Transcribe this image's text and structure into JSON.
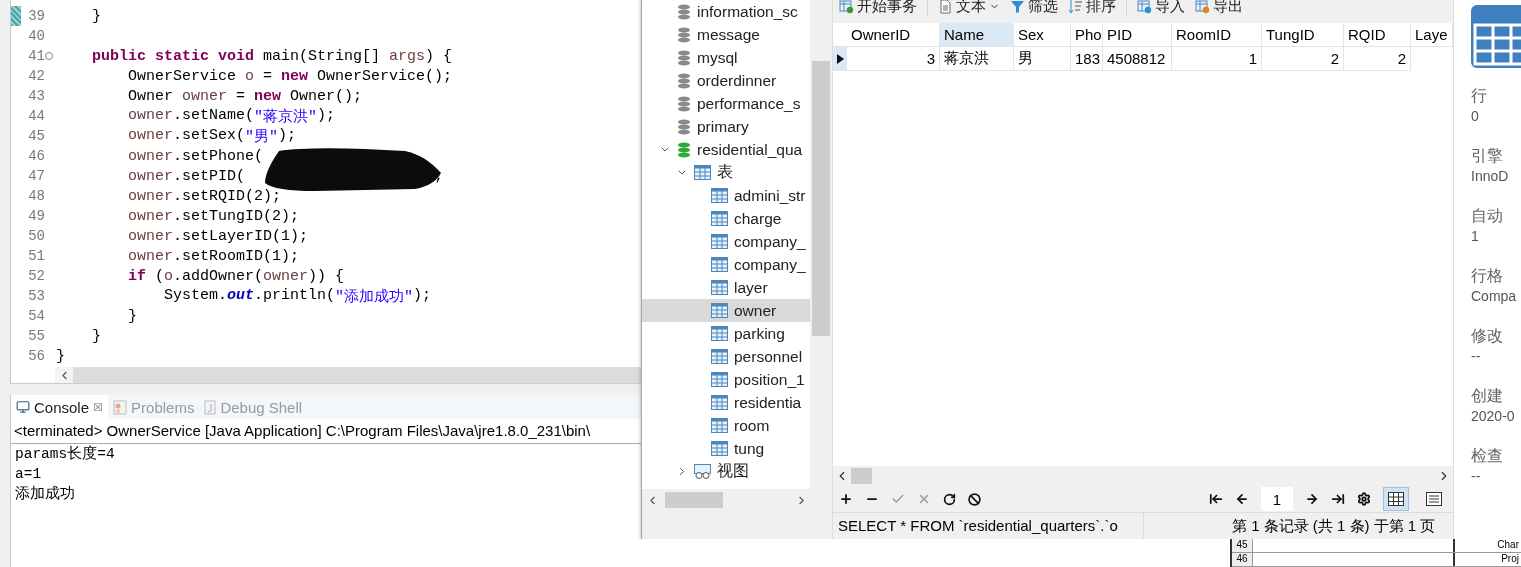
{
  "editor": {
    "lines": [
      {
        "number": "39",
        "marker": true,
        "tokens": [
          {
            "kind": "plain",
            "text": "    }"
          }
        ]
      },
      {
        "number": "40"
      },
      {
        "number": "41",
        "fold": true,
        "tokens": [
          {
            "kind": "keyword",
            "text": "    public static void"
          },
          {
            "kind": "plain",
            "text": " main(String[] "
          },
          {
            "kind": "variable",
            "text": "args"
          },
          {
            "kind": "plain",
            "text": ") {"
          }
        ]
      },
      {
        "number": "42",
        "tokens": [
          {
            "kind": "plain",
            "text": "        OwnerService "
          },
          {
            "kind": "variable",
            "text": "o"
          },
          {
            "kind": "plain",
            "text": " = "
          },
          {
            "kind": "keyword",
            "text": "new"
          },
          {
            "kind": "plain",
            "text": " OwnerService();"
          }
        ]
      },
      {
        "number": "43",
        "tokens": [
          {
            "kind": "plain",
            "text": "        Owner "
          },
          {
            "kind": "variable",
            "text": "owner"
          },
          {
            "kind": "plain",
            "text": " = "
          },
          {
            "kind": "keyword",
            "text": "new"
          },
          {
            "kind": "plain",
            "text": " Owner();"
          }
        ]
      },
      {
        "number": "44",
        "tokens": [
          {
            "kind": "variable",
            "text": "        owner"
          },
          {
            "kind": "plain",
            "text": ".setName("
          },
          {
            "kind": "string",
            "text": "\"蒋京洪\""
          },
          {
            "kind": "plain",
            "text": ");"
          }
        ]
      },
      {
        "number": "45",
        "tokens": [
          {
            "kind": "variable",
            "text": "        owner"
          },
          {
            "kind": "plain",
            "text": ".setSex("
          },
          {
            "kind": "string",
            "text": "\"男\""
          },
          {
            "kind": "plain",
            "text": ");"
          }
        ]
      },
      {
        "number": "46",
        "tokens": [
          {
            "kind": "variable",
            "text": "        owner"
          },
          {
            "kind": "plain",
            "text": ".setPhone("
          }
        ]
      },
      {
        "number": "47",
        "tokens": [
          {
            "kind": "variable",
            "text": "        owner"
          },
          {
            "kind": "plain",
            "text": ".setPID("
          }
        ],
        "after_redaction": ";"
      },
      {
        "number": "48",
        "tokens": [
          {
            "kind": "variable",
            "text": "        owner"
          },
          {
            "kind": "plain",
            "text": ".setRQID(2);"
          }
        ]
      },
      {
        "number": "49",
        "tokens": [
          {
            "kind": "variable",
            "text": "        owner"
          },
          {
            "kind": "plain",
            "text": ".setTungID(2);"
          }
        ]
      },
      {
        "number": "50",
        "tokens": [
          {
            "kind": "variable",
            "text": "        owner"
          },
          {
            "kind": "plain",
            "text": ".setLayerID(1);"
          }
        ]
      },
      {
        "number": "51",
        "tokens": [
          {
            "kind": "variable",
            "text": "        owner"
          },
          {
            "kind": "plain",
            "text": ".setRoomID(1);"
          }
        ]
      },
      {
        "number": "52",
        "tokens": [
          {
            "kind": "keyword",
            "text": "        if"
          },
          {
            "kind": "plain",
            "text": " ("
          },
          {
            "kind": "variable",
            "text": "o"
          },
          {
            "kind": "plain",
            "text": ".addOwner("
          },
          {
            "kind": "variable",
            "text": "owner"
          },
          {
            "kind": "plain",
            "text": ")) {"
          }
        ]
      },
      {
        "number": "53",
        "tokens": [
          {
            "kind": "plain",
            "text": "            System."
          },
          {
            "kind": "static",
            "text": "out"
          },
          {
            "kind": "plain",
            "text": ".println("
          },
          {
            "kind": "string",
            "text": "\"添加成功\""
          },
          {
            "kind": "plain",
            "text": ");"
          }
        ]
      },
      {
        "number": "54",
        "tokens": [
          {
            "kind": "plain",
            "text": "        }"
          }
        ]
      },
      {
        "number": "55",
        "tokens": [
          {
            "kind": "plain",
            "text": "    }"
          }
        ]
      },
      {
        "number": "56",
        "tokens": [
          {
            "kind": "plain",
            "text": "}"
          }
        ]
      }
    ]
  },
  "console": {
    "tabs": [
      {
        "label": "Console",
        "kind": "console",
        "selected": true,
        "close": "☒"
      },
      {
        "label": "Problems",
        "kind": "problems",
        "selected": false
      },
      {
        "label": "Debug Shell",
        "kind": "debug",
        "selected": false
      }
    ],
    "header": "<terminated> OwnerService [Java Application] C:\\Program Files\\Java\\jre1.8.0_231\\bin\\",
    "output": [
      "params长度=4",
      "a=1",
      "添加成功"
    ]
  },
  "navicat": {
    "tree": [
      {
        "name": "information_sc",
        "open": false,
        "selected": false
      },
      {
        "name": "message",
        "open": false,
        "selected": false
      },
      {
        "name": "mysql",
        "open": false,
        "selected": false
      },
      {
        "name": "orderdinner",
        "open": false,
        "selected": false
      },
      {
        "name": "performance_s",
        "open": false,
        "selected": false
      },
      {
        "name": "primary",
        "open": false,
        "selected": false
      },
      {
        "name": "residential_qua",
        "open": true,
        "selected": false,
        "children": [
          {
            "name": "表",
            "kind": "tables",
            "expanded": true,
            "selected": false,
            "children": [
              {
                "name": "admini_str",
                "selected": false
              },
              {
                "name": "charge",
                "selected": false
              },
              {
                "name": "company_",
                "selected": false
              },
              {
                "name": "company_",
                "selected": false
              },
              {
                "name": "layer",
                "selected": false
              },
              {
                "name": "owner",
                "selected": true
              },
              {
                "name": "parking",
                "selected": false
              },
              {
                "name": "personnel",
                "selected": false
              },
              {
                "name": "position_1",
                "selected": false
              },
              {
                "name": "residentia",
                "selected": false
              },
              {
                "name": "room",
                "selected": false
              },
              {
                "name": "tung",
                "selected": false
              }
            ]
          },
          {
            "name": "视图",
            "kind": "views",
            "expanded": false,
            "selected": false
          }
        ]
      }
    ],
    "toolbar": [
      {
        "label": "开始事务",
        "kind": "transaction"
      },
      {
        "label": "文本",
        "kind": "text",
        "dropdown": true
      },
      {
        "label": "筛选",
        "kind": "filter"
      },
      {
        "label": "排序",
        "kind": "sort"
      },
      {
        "label": "导入",
        "kind": "import"
      },
      {
        "label": "导出",
        "kind": "export"
      }
    ],
    "columns": [
      {
        "label": "OwnerID",
        "kind": "number",
        "selected": false
      },
      {
        "label": "Name",
        "kind": "text",
        "selected": true
      },
      {
        "label": "Sex",
        "kind": "text",
        "selected": false
      },
      {
        "label": "Pho",
        "kind": "text",
        "selected": false
      },
      {
        "label": "PID",
        "kind": "text",
        "selected": false
      },
      {
        "label": "RoomID",
        "kind": "number",
        "selected": false
      },
      {
        "label": "TungID",
        "kind": "number",
        "selected": false
      },
      {
        "label": "RQID",
        "kind": "number",
        "selected": false
      },
      {
        "label": "Laye",
        "selected": false
      }
    ],
    "rows": [
      {
        "current": true,
        "cells": [
          "3",
          "蒋京洪",
          "男",
          "183",
          "4508812",
          "1",
          "2",
          "2"
        ]
      }
    ],
    "nav": {
      "page": "1",
      "views": [
        {
          "kind": "grid",
          "selected": true
        },
        {
          "kind": "form",
          "selected": false
        }
      ]
    },
    "status": {
      "sql": "SELECT * FROM `residential_quarters`.`o",
      "records": "第 1 条记录 (共 1 条) 于第 1 页"
    },
    "info": [
      {
        "label": "行",
        "value": "0"
      },
      {
        "label": "引擎",
        "value": "InnoD"
      },
      {
        "label": "自动",
        "value": "1"
      },
      {
        "label": "行格",
        "value": "Compa"
      },
      {
        "label": "修改",
        "value": "--"
      },
      {
        "label": "创建",
        "value": "2020-0"
      },
      {
        "label": "检查",
        "value": "--"
      }
    ]
  },
  "sheet": {
    "rows": [
      {
        "number": "45",
        "text": "Char"
      },
      {
        "number": "46",
        "text": "Proj"
      }
    ]
  }
}
